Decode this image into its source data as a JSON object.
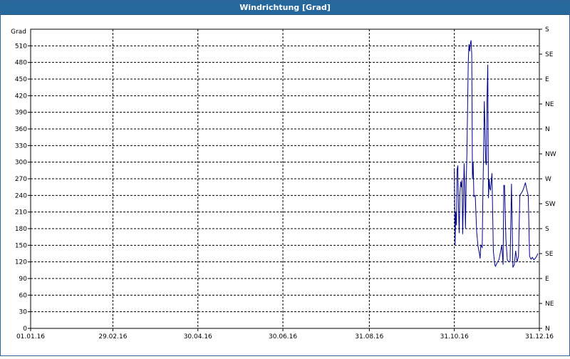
{
  "window": {
    "title": "Windrichtung [Grad]"
  },
  "colors": {
    "titlebar": "#26679c",
    "series": "#00008b",
    "grid": "#000000"
  },
  "chart_data": {
    "type": "line",
    "title": "Windrichtung [Grad]",
    "ylabel": "Grad",
    "xlabel": "",
    "ylim": [
      0,
      540
    ],
    "xlim": [
      "2016-01-01",
      "2016-12-31"
    ],
    "grid": true,
    "y_ticks": [
      0,
      30,
      60,
      90,
      120,
      150,
      180,
      210,
      240,
      270,
      300,
      330,
      360,
      390,
      420,
      450,
      480,
      510
    ],
    "x_ticks": [
      "2016-01-01",
      "2016-02-29",
      "2016-04-30",
      "2016-06-30",
      "2016-08-31",
      "2016-10-31",
      "2016-12-31"
    ],
    "x_tick_labels": [
      "01.01.16",
      "29.02.16",
      "30.04.16",
      "30.06.16",
      "31.08.16",
      "31.10.16",
      "31.12.16"
    ],
    "right_axis_labels": [
      {
        "value": 0,
        "label": "N"
      },
      {
        "value": 45,
        "label": "NE"
      },
      {
        "value": 90,
        "label": "E"
      },
      {
        "value": 135,
        "label": "SE"
      },
      {
        "value": 180,
        "label": "S"
      },
      {
        "value": 225,
        "label": "SW"
      },
      {
        "value": 270,
        "label": "W"
      },
      {
        "value": 315,
        "label": "NW"
      },
      {
        "value": 360,
        "label": "N"
      },
      {
        "value": 405,
        "label": "NE"
      },
      {
        "value": 450,
        "label": "E"
      },
      {
        "value": 495,
        "label": "SE"
      },
      {
        "value": 540,
        "label": "S"
      }
    ],
    "series": [
      {
        "x": [
          "2016-10-31",
          "2016-10-31",
          "2016-11-01",
          "2016-11-01",
          "2016-11-02",
          "2016-11-02",
          "2016-11-03",
          "2016-11-03",
          "2016-11-04",
          "2016-11-04",
          "2016-11-05",
          "2016-11-05",
          "2016-11-06",
          "2016-11-07",
          "2016-11-07",
          "2016-11-08",
          "2016-11-08",
          "2016-11-09",
          "2016-11-10",
          "2016-11-10",
          "2016-11-11",
          "2016-11-11",
          "2016-11-12",
          "2016-11-12",
          "2016-11-13",
          "2016-11-13",
          "2016-11-14",
          "2016-11-15",
          "2016-11-16",
          "2016-11-17",
          "2016-11-18",
          "2016-11-18",
          "2016-11-19",
          "2016-11-20",
          "2016-11-20",
          "2016-11-21",
          "2016-11-21",
          "2016-11-22",
          "2016-11-22",
          "2016-11-23",
          "2016-11-23",
          "2016-11-24",
          "2016-11-24",
          "2016-11-25",
          "2016-11-25",
          "2016-11-26",
          "2016-11-27",
          "2016-11-28",
          "2016-11-29",
          "2016-11-29",
          "2016-11-30",
          "2016-12-01",
          "2016-12-02",
          "2016-12-03",
          "2016-12-04",
          "2016-12-05",
          "2016-12-05",
          "2016-12-06",
          "2016-12-07",
          "2016-12-08",
          "2016-12-09",
          "2016-12-10",
          "2016-12-11",
          "2016-12-12",
          "2016-12-13",
          "2016-12-14",
          "2016-12-15",
          "2016-12-16",
          "2016-12-17",
          "2016-12-18",
          "2016-12-19",
          "2016-12-20",
          "2016-12-21",
          "2016-12-22",
          "2016-12-23",
          "2016-12-24",
          "2016-12-25",
          "2016-12-26",
          "2016-12-27",
          "2016-12-28",
          "2016-12-29",
          "2016-12-30"
        ],
        "values": [
          286,
          150,
          210,
          186,
          287,
          294,
          220,
          172,
          240,
          265,
          255,
          268,
          170,
          298,
          258,
          180,
          262,
          314,
          480,
          513,
          500,
          514,
          520,
          495,
          270,
          300,
          238,
          240,
          175,
          148,
          135,
          126,
          150,
          146,
          250,
          320,
          410,
          360,
          300,
          295,
          415,
          476,
          235,
          270,
          252,
          250,
          280,
          140,
          115,
          112,
          115,
          120,
          124,
          136,
          150,
          115,
          258,
          258,
          160,
          124,
          120,
          121,
          261,
          110,
          115,
          140,
          120,
          130,
          240,
          244,
          248,
          255,
          263,
          250,
          240,
          130,
          125,
          128,
          124,
          126,
          130,
          135
        ]
      }
    ]
  }
}
